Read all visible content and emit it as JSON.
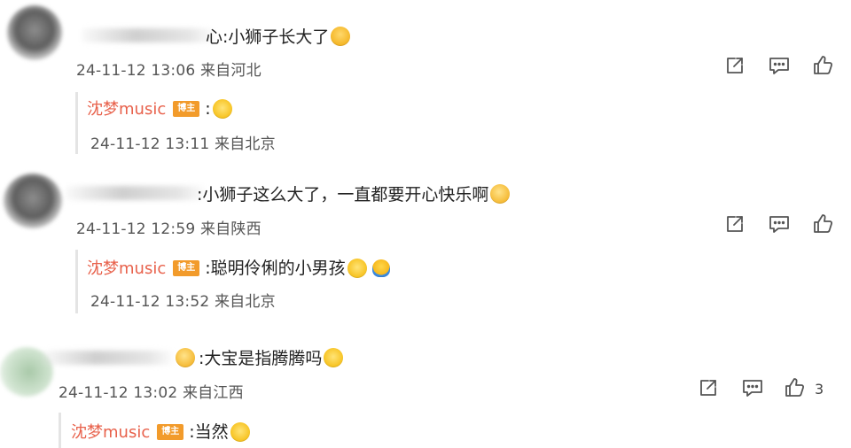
{
  "comments": [
    {
      "text": "心:小狮子长大了",
      "emoji": "party-face-emoji",
      "time": "24-11-12 13:06",
      "location": "来自河北",
      "reply": {
        "user": "沈梦music",
        "badge": "博主",
        "text": ":",
        "emoji": "smile-emoji",
        "time": "24-11-12 13:11",
        "location": "来自北京"
      }
    },
    {
      "text": ":小狮子这么大了，一直都要开心快乐啊",
      "emoji": "tease-emoji",
      "time": "24-11-12 12:59",
      "location": "来自陕西",
      "reply": {
        "user": "沈梦music",
        "badge": "博主",
        "text": ":聪明伶俐的小男孩",
        "emoji": "smile-emoji",
        "emoji2": "duck-emoji",
        "time": "24-11-12 13:52",
        "location": "来自北京"
      }
    },
    {
      "text": ":大宝是指腾腾吗",
      "emoji": "thinking-emoji",
      "time": "24-11-12 13:02",
      "location": "来自江西",
      "likes": "3",
      "reply": {
        "user": "沈梦music",
        "badge": "博主",
        "text": ":当然",
        "emoji": "smile-emoji"
      }
    }
  ],
  "actions": {
    "share_icon": "share-icon",
    "comment_icon": "comment-icon",
    "like_icon": "like-icon"
  },
  "colors": {
    "username": "#e8614b",
    "badge": "#f29b2b",
    "meta": "#555555",
    "icon": "#555555"
  }
}
